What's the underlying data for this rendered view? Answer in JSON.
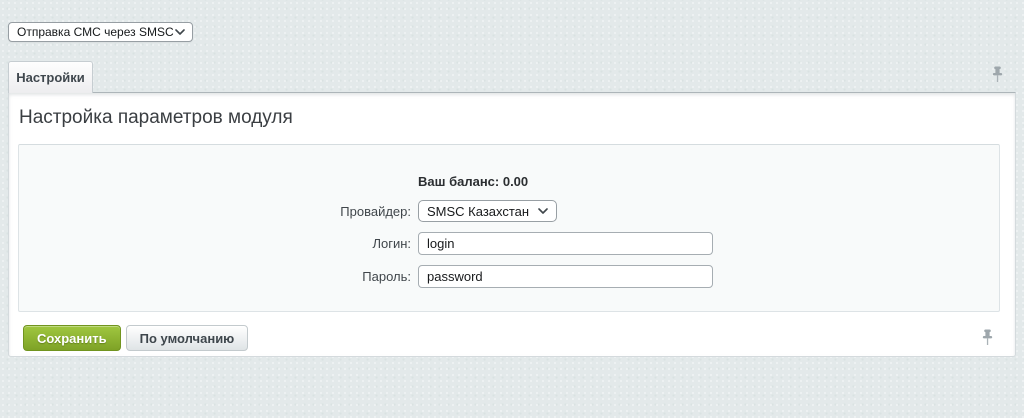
{
  "module_selector": {
    "value": "Отправка СМС через SMSC"
  },
  "tabs": [
    {
      "label": "Настройки",
      "active": true
    }
  ],
  "main": {
    "title": "Настройка параметров модуля",
    "balance_text": "Ваш баланс: 0.00"
  },
  "form": {
    "fields": [
      {
        "label": "Провайдер:",
        "type": "select",
        "value": "SMSC Казахстан"
      },
      {
        "label": "Логин:",
        "type": "text",
        "value": "login"
      },
      {
        "label": "Пароль:",
        "type": "text",
        "value": "password"
      }
    ]
  },
  "buttons": {
    "save_label": "Сохранить",
    "default_label": "По умолчанию"
  },
  "icons": {
    "top_right": "pin-icon",
    "bottom_right": "pin-icon",
    "selects": "chevron-down-icon"
  },
  "colors": {
    "page_background": "#e3e9ea",
    "panel_background": "#ffffff",
    "form_box_background": "#f8fafa",
    "save_button_green_top": "#a0c740",
    "save_button_green_bottom": "#7ea226",
    "pin_gray": "#9ea7ac"
  }
}
